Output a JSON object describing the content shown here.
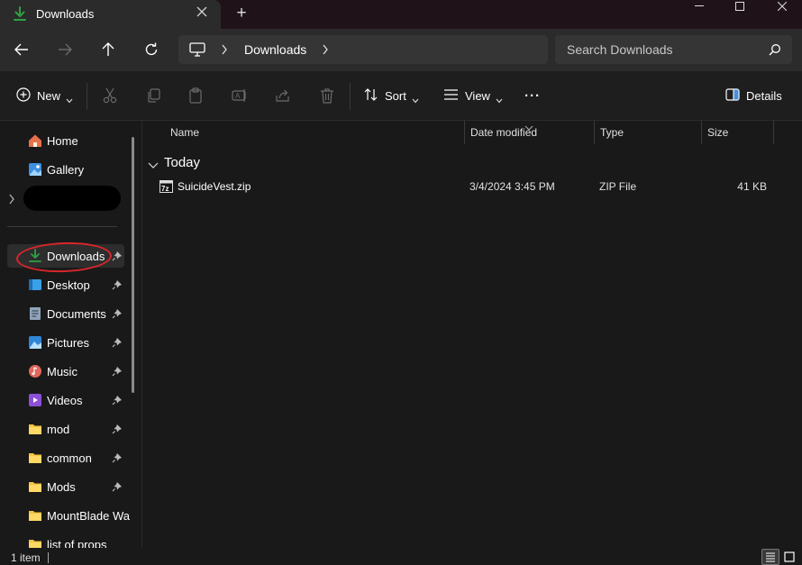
{
  "window": {
    "tab_title": "Downloads",
    "new_tab_label": "+"
  },
  "address": {
    "crumbs": [
      "Downloads"
    ],
    "search_placeholder": "Search Downloads"
  },
  "commands": {
    "new_label": "New",
    "sort_label": "Sort",
    "view_label": "View",
    "more_label": "···",
    "details_label": "Details"
  },
  "sidebar": {
    "items": [
      {
        "label": "Home",
        "icon": "home-icon"
      },
      {
        "label": "Gallery",
        "icon": "gallery-icon"
      },
      {
        "label": "Downloads",
        "icon": "download-icon",
        "pinned": true,
        "active": true
      },
      {
        "label": "Desktop",
        "icon": "desktop-icon",
        "pinned": true
      },
      {
        "label": "Documents",
        "icon": "documents-icon",
        "pinned": true
      },
      {
        "label": "Pictures",
        "icon": "pictures-icon",
        "pinned": true
      },
      {
        "label": "Music",
        "icon": "music-icon",
        "pinned": true
      },
      {
        "label": "Videos",
        "icon": "videos-icon",
        "pinned": true
      },
      {
        "label": "mod",
        "icon": "folder-icon",
        "pinned": true
      },
      {
        "label": "common",
        "icon": "folder-icon",
        "pinned": true
      },
      {
        "label": "Mods",
        "icon": "folder-icon",
        "pinned": true
      },
      {
        "label": "MountBlade Wa",
        "icon": "folder-icon"
      },
      {
        "label": "list of props",
        "icon": "folder-icon"
      }
    ]
  },
  "columns": {
    "name": "Name",
    "date": "Date modified",
    "type": "Type",
    "size": "Size"
  },
  "groups": [
    {
      "label": "Today",
      "files": [
        {
          "name": "SuicideVest.zip",
          "date": "3/4/2024 3:45 PM",
          "type": "ZIP File",
          "size": "41 KB"
        }
      ]
    }
  ],
  "status": {
    "item_count": "1 item"
  },
  "colors": {
    "accent": "#2ea043",
    "annotation_red": "#d9262b",
    "folder": "#f4c542"
  }
}
